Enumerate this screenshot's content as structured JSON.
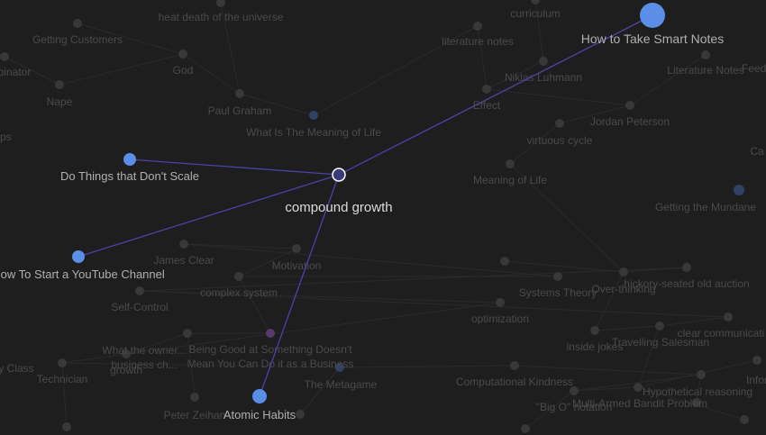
{
  "graph": {
    "focus": {
      "label": "compound growth"
    },
    "highlighted_nodes": [
      {
        "id": "smart-notes",
        "label": "How to Take Smart Notes",
        "size": "large"
      },
      {
        "id": "do-things",
        "label": "Do Things that Don't Scale",
        "size": "small"
      },
      {
        "id": "youtube",
        "label": "How To Start a YouTube Channel",
        "size": "small"
      },
      {
        "id": "atomic",
        "label": "Atomic Habits",
        "size": "small"
      }
    ],
    "edges": [
      [
        "focus",
        "smart-notes"
      ],
      [
        "focus",
        "do-things"
      ],
      [
        "focus",
        "youtube"
      ],
      [
        "focus",
        "atomic"
      ]
    ],
    "background_labels": [
      "Getting Customers",
      "heat death of the universe",
      "curriculum",
      "literature notes",
      "binator",
      "God",
      "Nape",
      "Niklas Luhmann",
      "Literature Notes",
      "Feedb",
      "Paul Graham",
      "Effect",
      "Jordan Peterson",
      "What Is The Meaning of Life",
      "virtuous cycle",
      "ips",
      "Meaning of Life",
      "Getting the Mundane",
      "Ca",
      "James Clear",
      "Motivation",
      "complex system",
      "Systems Theory",
      "hickory-seated old auction",
      "Over-thinking",
      "Self-Control",
      "optimization",
      "clear communicati",
      "What the owner...",
      "Being Good at Something Doesn't",
      "business ch...",
      "Mean You Can Do it as a Business",
      "Travelling Salesman",
      "inside jokes",
      "Technician",
      "growth",
      "The Metagame",
      "y Class",
      "Computational Kindness",
      "Hypothetical reasoning",
      "Infor",
      "Multi-Armed Bandit Problem",
      "Peter Zeihan",
      "\"Big O\" notation"
    ],
    "colors": {
      "background": "#1e1e1e",
      "edge_highlight": "#4a43a8",
      "node_highlight": "#5b8ee6",
      "focus_fill": "#3d3a7a",
      "node_dim": "#383838",
      "node_dim_blue": "#2f4266",
      "node_dim_purple": "#5a3870",
      "label_bright": "#dcdcdc",
      "label_mid": "#b0b0b0",
      "label_dim": "#4a4a4a"
    }
  }
}
